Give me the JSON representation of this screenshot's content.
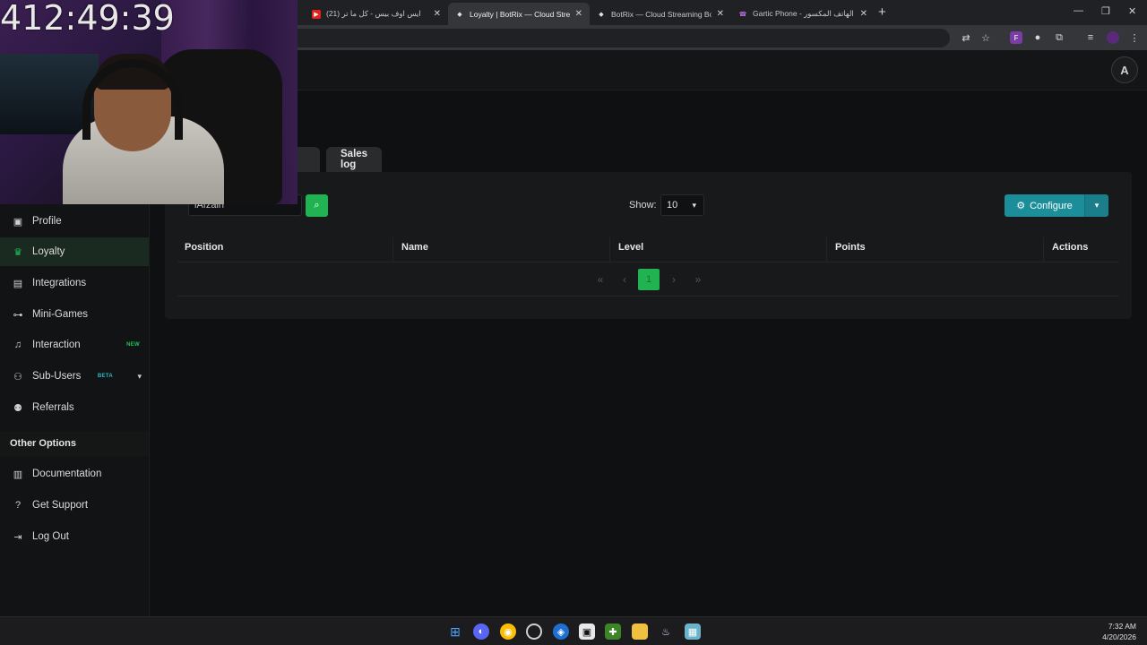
{
  "browser": {
    "tabs": [
      {
        "title": "(21) ايس اوف بيس - كل ما تر",
        "active": false
      },
      {
        "title": "Loyalty | BotRix — Cloud Stream",
        "active": true
      },
      {
        "title": "BotRix — Cloud Streaming Bot",
        "active": false
      },
      {
        "title": "Gartic Phone - الهاتف المكسور",
        "active": false
      }
    ],
    "new_tab": "+",
    "window_controls": [
      "—",
      "❐",
      "✕"
    ]
  },
  "webcam": {
    "timer": "412:49:39"
  },
  "header": {
    "logo_text": "A",
    "title_partial": ")"
  },
  "sidebar": {
    "items": [
      {
        "label": "Profile",
        "icon": "profile-icon"
      },
      {
        "label": "Loyalty",
        "icon": "trophy-icon"
      },
      {
        "label": "Integrations",
        "icon": "integrations-icon"
      },
      {
        "label": "Mini-Games",
        "icon": "gamepad-icon"
      },
      {
        "label": "Interaction",
        "icon": "music-note-icon",
        "badge": "NEW"
      },
      {
        "label": "Sub-Users",
        "icon": "users-icon",
        "badge": "BETA"
      },
      {
        "label": "Referrals",
        "icon": "referrals-icon"
      }
    ],
    "other_options_title": "Other Options",
    "other_items": [
      {
        "label": "Documentation",
        "icon": "book-icon"
      },
      {
        "label": "Get Support",
        "icon": "question-icon"
      },
      {
        "label": "Log Out",
        "icon": "logout-icon"
      }
    ]
  },
  "tabs": {
    "sales_log": "Sales log"
  },
  "search": {
    "value": "lAfzain"
  },
  "show": {
    "label": "Show:",
    "value": "10"
  },
  "configure": {
    "label": "Configure"
  },
  "table": {
    "columns": [
      "Position",
      "Name",
      "Level",
      "Points",
      "Actions"
    ]
  },
  "pagination": {
    "first": "«",
    "prev": "‹",
    "current": "1",
    "next": "›",
    "last": "»"
  },
  "taskbar": {
    "time": "7:32 AM",
    "date": "4/20/2026"
  },
  "colors": {
    "accent_green": "#21b352",
    "configure_teal": "#1b8e9a",
    "background": "#0f1011"
  }
}
